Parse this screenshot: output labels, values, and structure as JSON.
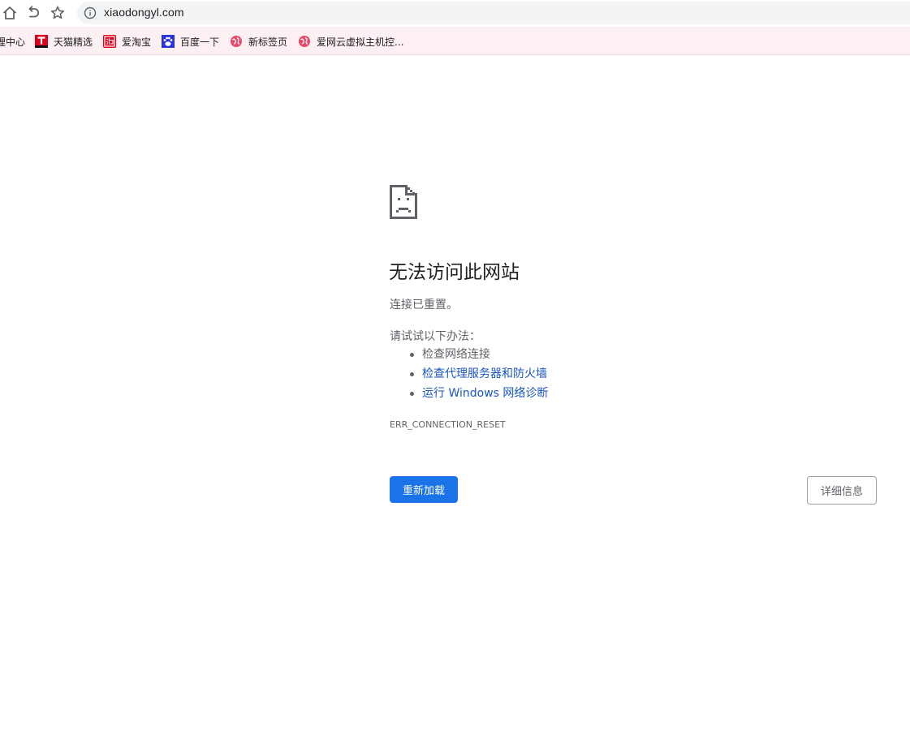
{
  "toolbar": {
    "home_icon": "home-icon",
    "reload_icon": "reload-icon",
    "bookmark_icon": "star-icon",
    "site_info_icon": "info-icon",
    "url": "xiaodongyl.com"
  },
  "bookmarks": [
    {
      "label": "理中心",
      "icon": "none"
    },
    {
      "label": "天猫精选",
      "icon": "tmall-icon",
      "color": "#e0001b"
    },
    {
      "label": "爱淘宝",
      "icon": "taobao-icon",
      "color": "#e0001b"
    },
    {
      "label": "百度一下",
      "icon": "baidu-paw-icon",
      "color": "#2932e1"
    },
    {
      "label": "新标签页",
      "icon": "globe-icon",
      "color": "#e84a6a"
    },
    {
      "label": "爱网云虚拟主机控...",
      "icon": "globe-icon",
      "color": "#e84a6a"
    }
  ],
  "error": {
    "icon": "sad-page-icon",
    "title": "无法访问此网站",
    "subtitle": "连接已重置。",
    "try_label": "请试试以下办法：",
    "suggestions": [
      {
        "text": "检查网络连接",
        "link": false
      },
      {
        "text": "检查代理服务器和防火墙",
        "link": true
      },
      {
        "text": "运行 Windows 网络诊断",
        "link": true
      }
    ],
    "code": "ERR_CONNECTION_RESET"
  },
  "buttons": {
    "reload": "重新加载",
    "details": "详细信息"
  },
  "colors": {
    "accent": "#1a73e8",
    "link": "#1a55c4",
    "bookmark_bar": "#fdf0f2"
  }
}
